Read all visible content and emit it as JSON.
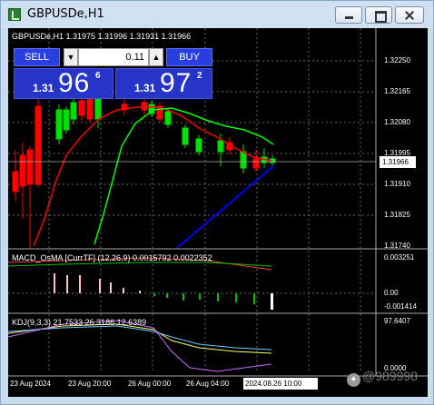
{
  "window": {
    "title": "GBPUSDe,H1"
  },
  "chart": {
    "symbol_info": "GBPUSDe,H1  1.31975 1.31996 1.31931 1.31966",
    "trade_panel": {
      "sell_label": "SELL",
      "buy_label": "BUY",
      "lot_value": "0.11",
      "lot_down_glyph": "▼",
      "lot_up_glyph": "▲",
      "bid": {
        "prefix": "1.31",
        "big": "96",
        "sup": "6"
      },
      "ask": {
        "prefix": "1.31",
        "big": "97",
        "sup": "2"
      }
    },
    "price_scale": [
      "1.32250",
      "1.32165",
      "1.32080",
      "1.31995",
      "1.31910",
      "1.31825",
      "1.31740"
    ],
    "current_price": "1.31966",
    "macd_label": "MACD_OsMA [CurrTF] (12,26,9) 0.0015792 0.0022352",
    "macd_scale": [
      "0.003251",
      "0.00",
      "-0.001414"
    ],
    "kdj_label": "KDJ(9,3,3) 21.7533 26.3186 12.6389",
    "kdj_scale": [
      "97.6407",
      "0.0000"
    ],
    "time_axis": [
      "23 Aug 2024",
      "23 Aug 20:00",
      "26 Aug 00:00",
      "26 Aug 04:00",
      "2024.08.26 10:00"
    ],
    "colors": {
      "background": "#000000",
      "bull_candle": "#00e000",
      "bear_candle": "#ff0000",
      "ma_fast": "#ff0000",
      "ma_slow": "#00ff00",
      "trend_line": "#0000ff",
      "grid": "#666666"
    }
  },
  "watermark": {
    "text": "@989998",
    "icon": "weibo-icon"
  }
}
